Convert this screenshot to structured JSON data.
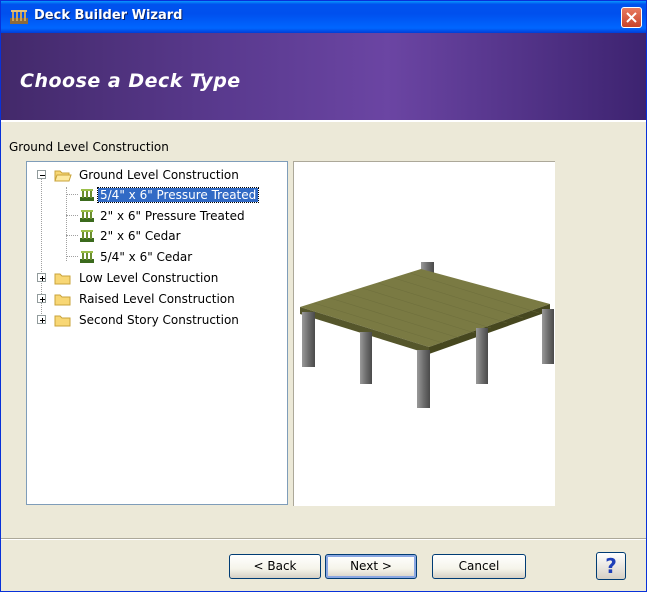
{
  "window": {
    "title": "Deck Builder Wizard"
  },
  "banner": {
    "title": "Choose a Deck Type"
  },
  "section_label": "Ground Level Construction",
  "tree": {
    "items": [
      {
        "label": "Ground Level Construction",
        "expanded": true,
        "children": [
          {
            "label": "5/4\" x 6\" Pressure Treated",
            "selected": true
          },
          {
            "label": "2\" x 6\" Pressure Treated"
          },
          {
            "label": "2\" x 6\" Cedar"
          },
          {
            "label": "5/4\" x 6\" Cedar"
          }
        ]
      },
      {
        "label": "Low Level Construction",
        "expanded": false
      },
      {
        "label": "Raised Level Construction",
        "expanded": false
      },
      {
        "label": "Second Story Construction",
        "expanded": false
      }
    ]
  },
  "buttons": {
    "back": "< Back",
    "next": "Next >",
    "cancel": "Cancel",
    "help": "?"
  },
  "colors": {
    "banner": "#5a3a8f",
    "titlebar": "#0053ee",
    "selection": "#316ac5"
  }
}
